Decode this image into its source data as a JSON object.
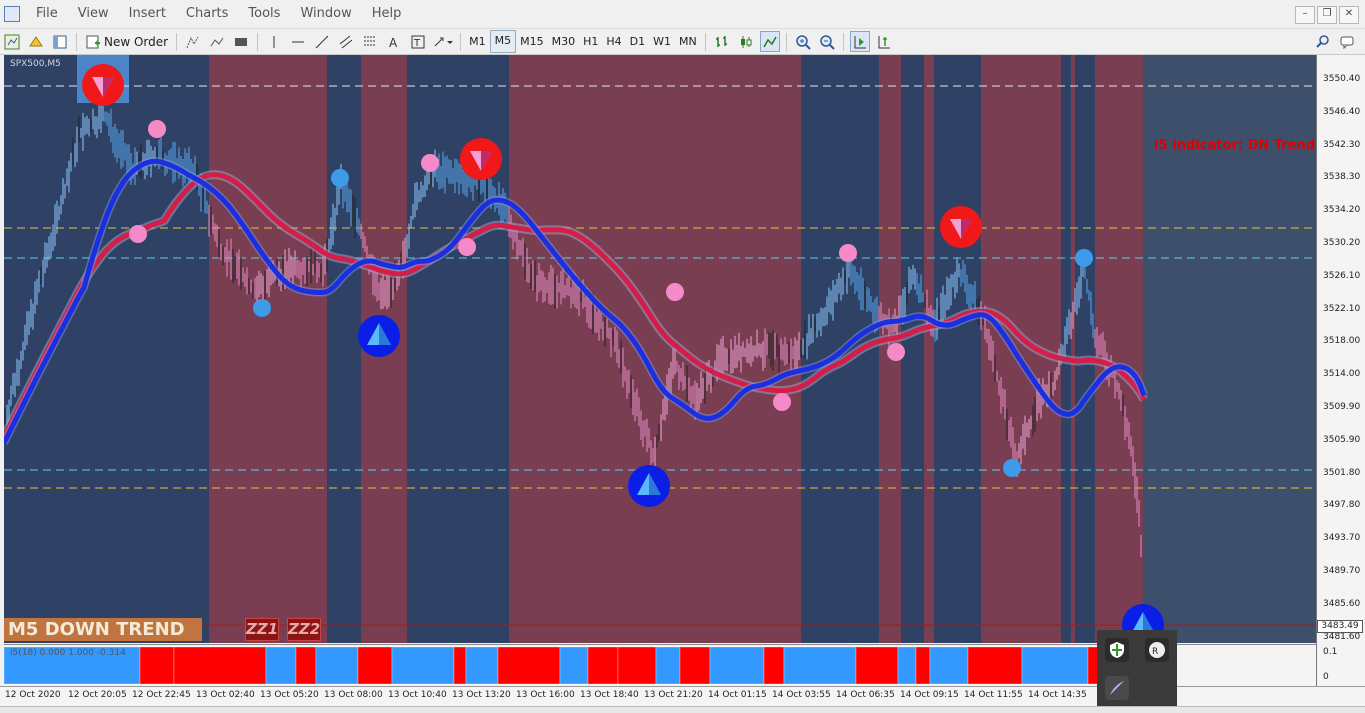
{
  "menu": [
    "File",
    "View",
    "Insert",
    "Charts",
    "Tools",
    "Window",
    "Help"
  ],
  "toolbar": {
    "new_order_label": "New Order",
    "timeframes": [
      "M1",
      "M5",
      "M15",
      "M30",
      "H1",
      "H4",
      "D1",
      "W1",
      "MN"
    ],
    "active_timeframe": "M5"
  },
  "chart": {
    "symbol": "SPX500,M5",
    "indicator_status": "i5 Indicator: DN Trend",
    "trend_badge": "M5 DOWN TREND",
    "zz_buttons": [
      "ZZ1",
      "ZZ2"
    ],
    "current_price": "3483.49",
    "price_labels": [
      "3550.40",
      "3546.40",
      "3542.30",
      "3538.30",
      "3534.20",
      "3530.20",
      "3526.10",
      "3522.10",
      "3518.00",
      "3514.00",
      "3509.90",
      "3505.90",
      "3501.80",
      "3497.80",
      "3493.70",
      "3489.70",
      "3485.60",
      "3481.60"
    ],
    "indicator_scale": [
      "0.1",
      "0"
    ],
    "indicator_label": "i5(18) 0.000 1.000 -0.314",
    "time_labels": [
      "12 Oct 2020",
      "12 Oct 20:05",
      "12 Oct 22:45",
      "13 Oct 02:40",
      "13 Oct 05:20",
      "13 Oct 08:00",
      "13 Oct 10:40",
      "13 Oct 13:20",
      "13 Oct 16:00",
      "13 Oct 18:40",
      "13 Oct 21:20",
      "14 Oct 01:15",
      "14 Oct 03:55",
      "14 Oct 06:35",
      "14 Oct 09:15",
      "14 Oct 11:55",
      "14 Oct 14:35"
    ],
    "colors": {
      "background_blue": "#2f4266",
      "background_red": "#7a3e52",
      "fast_line": "#1a2fe0",
      "slow_line": "#d41e48",
      "histogram_red": "#ff0000",
      "histogram_blue": "#3399ff",
      "trend_text": "#e00000"
    }
  }
}
